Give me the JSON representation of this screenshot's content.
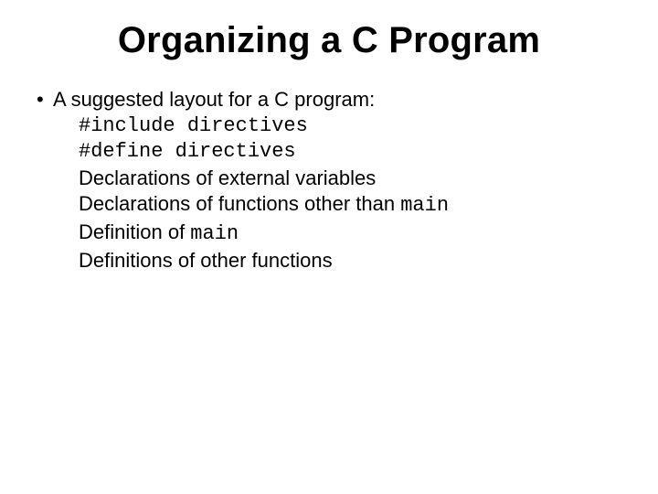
{
  "title": "Organizing a C Program",
  "bullet": {
    "dot": "•",
    "text": "A suggested layout for a C program:"
  },
  "lines": {
    "l1": "#include directives",
    "l2": "#define directives",
    "l3": "Declarations of external variables",
    "l4_a": "Declarations of functions other than ",
    "l4_b": "main",
    "l5_a": "Definition of ",
    "l5_b": "main",
    "l6": "Definitions of other functions"
  }
}
